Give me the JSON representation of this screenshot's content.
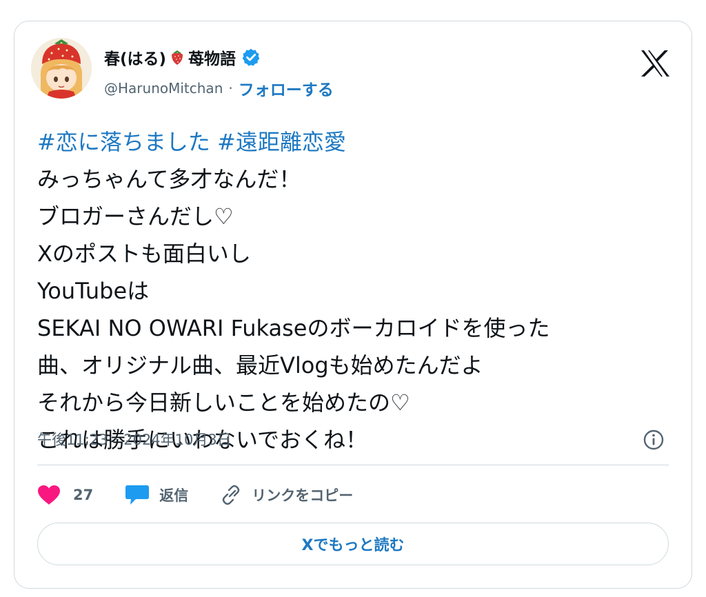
{
  "author": {
    "display_name": "春(はる)",
    "name_suffix": "苺物語",
    "handle": "@HarunoMitchan",
    "separator": "·",
    "follow_label": "フォローする",
    "verified": true
  },
  "tweet": {
    "hashtags": [
      "#恋に落ちました",
      "#遠距離恋愛"
    ],
    "lines": [
      "みっちゃんて多才なんだ！",
      "ブロガーさんだし♡",
      "Xのポストも面白いし",
      "YouTubeは",
      "SEKAI NO OWARI Fukaseのボーカロイドを使った",
      "曲、オリジナル曲、最近Vlogも始めたんだよ",
      "それから今日新しいことを始めたの♡",
      "これは勝手にいわないでおくね！"
    ],
    "time": "午後11:23",
    "time_separator": "·",
    "date": "2024年10月3日"
  },
  "actions": {
    "like_count": "27",
    "reply_label": "返信",
    "copy_link_label": "リンクをコピー"
  },
  "read_more_label": "Xでもっと読む",
  "icons": {
    "platform_logo": "x-logo-icon",
    "verified": "verified-badge-icon",
    "strawberry": "strawberry-icon",
    "info": "info-icon",
    "like": "heart-icon",
    "reply": "speech-bubble-icon",
    "copy_link": "link-icon"
  },
  "colors": {
    "link_blue": "#1d78c2",
    "verified_blue": "#1d9bf0",
    "heart_red": "#f91880",
    "muted_text": "#536471",
    "border": "#cfd9de"
  }
}
